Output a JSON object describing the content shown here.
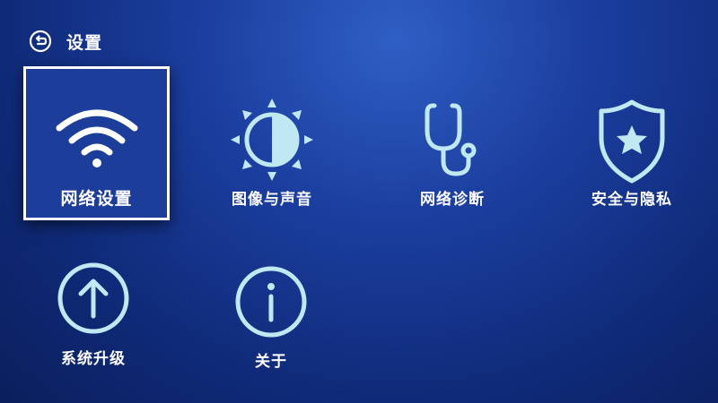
{
  "header": {
    "title": "设置"
  },
  "tiles": [
    {
      "label": "网络设置",
      "icon": "wifi-icon",
      "focused": true
    },
    {
      "label": "图像与声音",
      "icon": "brightness-icon",
      "focused": false
    },
    {
      "label": "网络诊断",
      "icon": "stethoscope-icon",
      "focused": false
    },
    {
      "label": "安全与隐私",
      "icon": "shield-star-icon",
      "focused": false
    },
    {
      "label": "系统升级",
      "icon": "arrow-up-circle-icon",
      "focused": false
    },
    {
      "label": "关于",
      "icon": "info-circle-icon",
      "focused": false
    }
  ],
  "colors": {
    "icon_stroke": "#bfe8f2",
    "background": "#1b3e9f",
    "focus_border": "#ffffff"
  }
}
